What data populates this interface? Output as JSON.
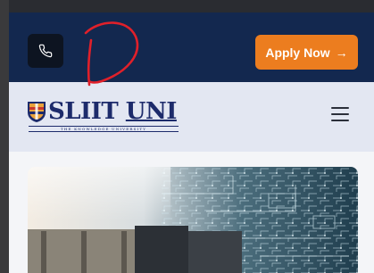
{
  "header": {
    "phone_icon": "phone-icon",
    "apply_button": {
      "label": "Apply Now",
      "icon": "arrow-right-icon",
      "arrow": "→"
    }
  },
  "navbar": {
    "logo": {
      "brand": "SLIIT",
      "brand_suffix": "UNI",
      "tagline": "THE KNOWLEDGE UNIVERSITY"
    },
    "menu_icon": "hamburger-menu-icon"
  },
  "hero": {
    "image": "technology-circuit-hero-image"
  },
  "colors": {
    "topbar": "#13284f",
    "apply_button": "#ec7d1f",
    "navbar": "#e3e7f2",
    "logo": "#1d2b6b",
    "annotation": "#e0202a"
  }
}
